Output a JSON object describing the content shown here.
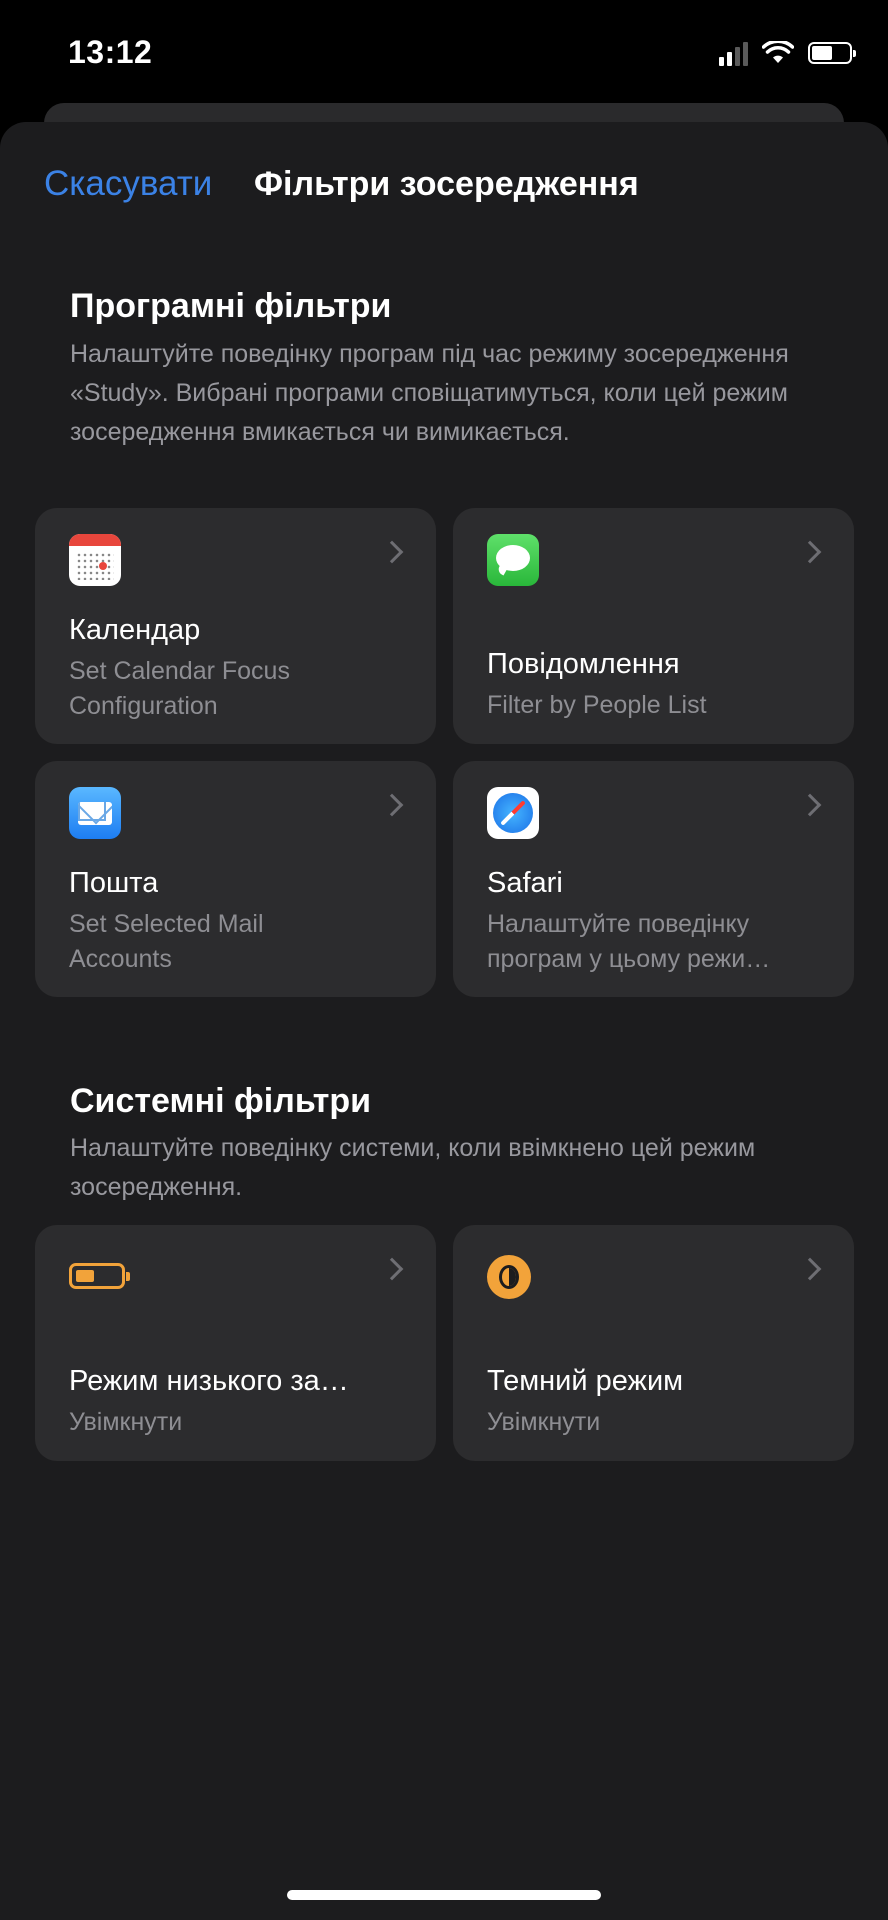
{
  "status_bar": {
    "time": "13:12"
  },
  "nav": {
    "cancel_label": "Скасувати",
    "title": "Фільтри зосередження"
  },
  "app_filters": {
    "title": "Програмні фільтри",
    "description": "Налаштуйте поведінку програм під час режиму зосередження «Study». Вибрані програми сповіщатимуться, коли цей режим зосередження вмикається чи вимикається.",
    "cards": [
      {
        "icon": "calendar-icon",
        "title": "Календар",
        "subtitle": "Set Calendar Focus Configuration"
      },
      {
        "icon": "messages-icon",
        "title": "Повідомлення",
        "subtitle": "Filter by People List"
      },
      {
        "icon": "mail-icon",
        "title": "Пошта",
        "subtitle": "Set Selected Mail Accounts"
      },
      {
        "icon": "safari-icon",
        "title": "Safari",
        "subtitle": "Налаштуйте поведінку програм у цьому режи…"
      }
    ]
  },
  "system_filters": {
    "title": "Системні фільтри",
    "description": "Налаштуйте поведінку системи, коли ввімкнено цей режим зосередження.",
    "cards": [
      {
        "icon": "low-power-battery-icon",
        "title": "Режим низького за…",
        "subtitle": "Увімкнути"
      },
      {
        "icon": "dark-mode-icon",
        "title": "Темний режим",
        "subtitle": "Увімкнути"
      }
    ]
  },
  "colors": {
    "accent": "#3b82e6",
    "sheet_background": "#1c1c1e",
    "card_background": "#2c2c2e",
    "secondary_text": "#8e8e93",
    "system_icon": "#f2a33a"
  }
}
